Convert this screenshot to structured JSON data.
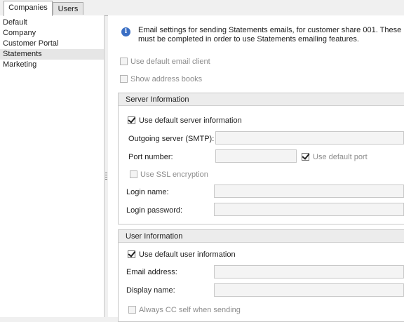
{
  "tabs": [
    {
      "label": "Companies"
    },
    {
      "label": "Users"
    }
  ],
  "sidebar": {
    "items": [
      {
        "label": "Default"
      },
      {
        "label": "Company"
      },
      {
        "label": "Customer Portal"
      },
      {
        "label": "Statements"
      },
      {
        "label": "Marketing"
      }
    ],
    "selected": "Statements"
  },
  "info": {
    "line1": "Email settings for sending Statements emails, for customer share 001.  These",
    "line2": "must be completed in order to use Statements emailing features."
  },
  "options": {
    "use_default_email_client": {
      "label": "Use default email client",
      "checked": false,
      "enabled": false
    },
    "show_address_books": {
      "label": "Show address books",
      "checked": false,
      "enabled": false
    }
  },
  "server": {
    "title": "Server Information",
    "use_default": {
      "label": "Use default server information",
      "checked": true
    },
    "smtp_label": "Outgoing server (SMTP):",
    "smtp_value": "",
    "port_label": "Port number:",
    "port_value": "",
    "use_default_port": {
      "label": "Use default port",
      "checked": true,
      "enabled": false
    },
    "ssl": {
      "label": "Use SSL encryption",
      "checked": false,
      "enabled": false
    },
    "login_name_label": "Login name:",
    "login_name_value": "",
    "login_password_label": "Login password:",
    "login_password_value": ""
  },
  "user": {
    "title": "User Information",
    "use_default": {
      "label": "Use default user information",
      "checked": true
    },
    "email_label": "Email address:",
    "email_value": "",
    "display_label": "Display name:",
    "display_value": "",
    "cc_self": {
      "label": "Always CC self when sending",
      "checked": false,
      "enabled": false
    }
  }
}
